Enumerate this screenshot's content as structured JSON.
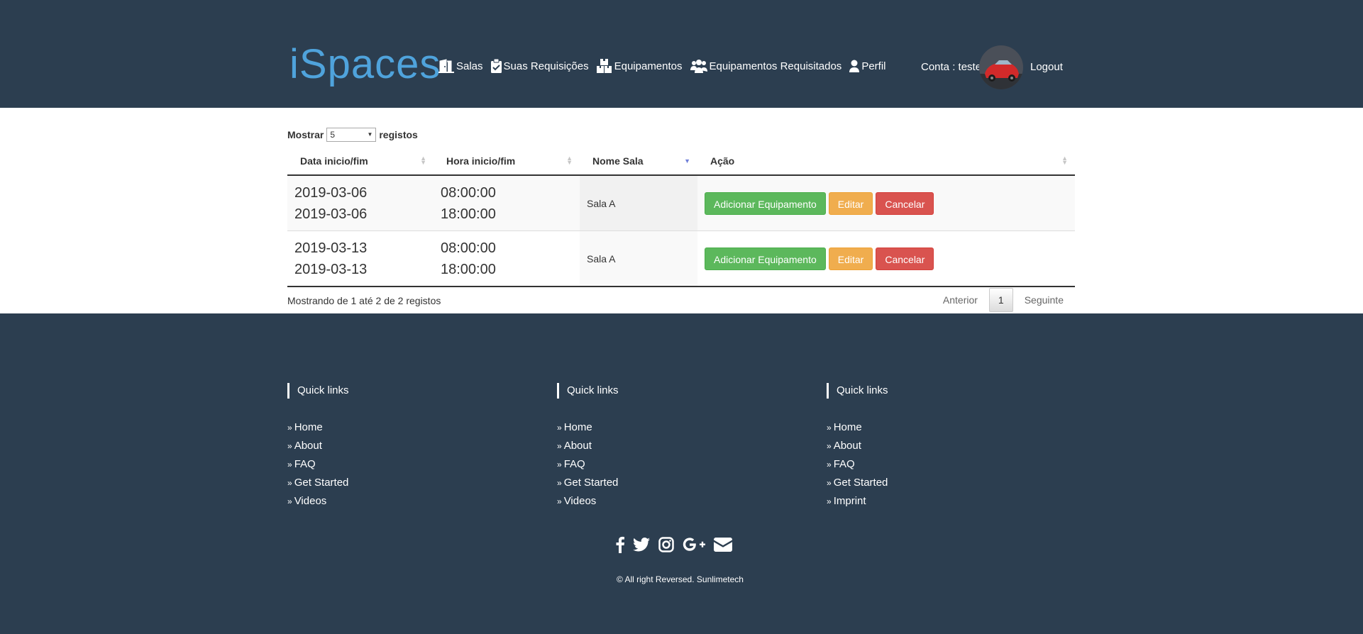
{
  "header": {
    "brand": "iSpaces",
    "nav": [
      {
        "label": "Salas",
        "icon": "door-icon"
      },
      {
        "label": "Suas Requisições",
        "icon": "clipboard-check-icon"
      },
      {
        "label": "Equipamentos",
        "icon": "boxes-icon"
      },
      {
        "label": "Equipamentos Requisitados",
        "icon": "users-icon"
      },
      {
        "label": "Perfil",
        "icon": "user-icon"
      }
    ],
    "account_label": "Conta : teste",
    "logout": "Logout"
  },
  "table": {
    "length_prefix": "Mostrar",
    "length_value": "5",
    "length_suffix": "registos",
    "columns": [
      "Data inicio/fim",
      "Hora inicio/fim",
      "Nome Sala",
      "Ação"
    ],
    "rows": [
      {
        "date_start": "2019-03-06",
        "date_end": "2019-03-06",
        "time_start": "08:00:00",
        "time_end": "18:00:00",
        "room": "Sala A"
      },
      {
        "date_start": "2019-03-13",
        "date_end": "2019-03-13",
        "time_start": "08:00:00",
        "time_end": "18:00:00",
        "room": "Sala A"
      }
    ],
    "actions": {
      "add": "Adicionar Equipamento",
      "edit": "Editar",
      "cancel": "Cancelar"
    },
    "info": "Mostrando de 1 até 2 de 2 registos",
    "pager": {
      "prev": "Anterior",
      "current": "1",
      "next": "Seguinte"
    }
  },
  "footer": {
    "columns": [
      {
        "title": "Quick links",
        "links": [
          "Home",
          "About",
          "FAQ",
          "Get Started",
          "Videos"
        ]
      },
      {
        "title": "Quick links",
        "links": [
          "Home",
          "About",
          "FAQ",
          "Get Started",
          "Videos"
        ]
      },
      {
        "title": "Quick links",
        "links": [
          "Home",
          "About",
          "FAQ",
          "Get Started",
          "Imprint"
        ]
      }
    ],
    "copyright": "© All right Reversed.  Sunlimetech",
    "social_icons": [
      "facebook-icon",
      "twitter-icon",
      "instagram-icon",
      "google-plus-icon",
      "envelope-icon"
    ]
  },
  "colors": {
    "header_bg": "#2c3e50",
    "brand": "#4fa3dc",
    "green": "#5cb85c",
    "orange": "#f0ad4e",
    "red": "#d9534f"
  }
}
